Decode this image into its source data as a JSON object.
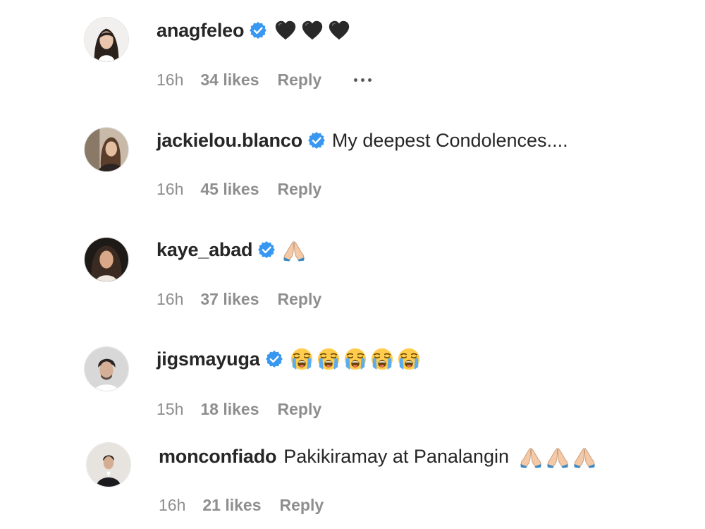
{
  "comments": [
    {
      "username": "anagfeleo",
      "verified": true,
      "text": "",
      "emojis": [
        "black-heart-icon",
        "black-heart-icon",
        "black-heart-icon"
      ],
      "time": "16h",
      "likes": "34 likes",
      "reply": "Reply",
      "has_more_menu": true
    },
    {
      "username": "jackielou.blanco",
      "verified": true,
      "text": "My deepest Condolences....",
      "emojis": [],
      "time": "16h",
      "likes": "45 likes",
      "reply": "Reply"
    },
    {
      "username": "kaye_abad",
      "verified": true,
      "text": "",
      "emojis": [
        "folded-hands-icon"
      ],
      "time": "16h",
      "likes": "37 likes",
      "reply": "Reply"
    },
    {
      "username": "jigsmayuga",
      "verified": true,
      "text": "",
      "emojis": [
        "loudly-crying-face-icon",
        "loudly-crying-face-icon",
        "loudly-crying-face-icon",
        "loudly-crying-face-icon",
        "loudly-crying-face-icon"
      ],
      "time": "15h",
      "likes": "18 likes",
      "reply": "Reply"
    },
    {
      "username": "monconfiado",
      "verified": false,
      "text": "Pakikiramay at Panalangin",
      "emojis": [
        "folded-hands-icon",
        "folded-hands-icon",
        "folded-hands-icon"
      ],
      "time": "16h",
      "likes": "21 likes",
      "reply": "Reply"
    }
  ],
  "colors": {
    "verified_blue": "#3897f0",
    "meta_gray": "#8e8e8e",
    "text_dark": "#262626"
  }
}
